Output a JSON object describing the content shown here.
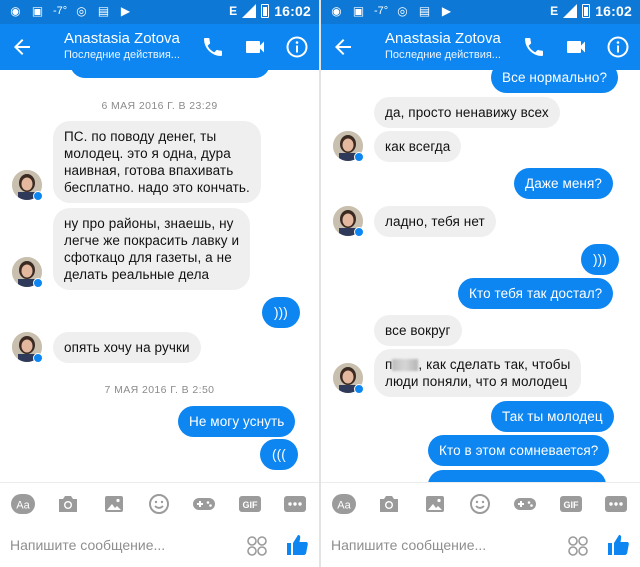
{
  "status_bar": {
    "temperature": "-7°",
    "network": "E",
    "time": "16:02"
  },
  "header": {
    "contact_name": "Anastasia Zotova",
    "contact_status": "Последние действия..."
  },
  "left_pane": {
    "timestamps": [
      "6 МАЯ 2016 Г. В 23:29",
      "7 МАЯ 2016 Г. В 2:50"
    ],
    "messages": [
      {
        "from": "contact",
        "lines": [
          "ПС. по поводу денег, ты",
          "молодец. это я одна, дура",
          "наивная, готова впахивать",
          "бесплатно. надо это кончать."
        ]
      },
      {
        "from": "contact",
        "lines": [
          "ну про районы, знаешь, ну",
          "легче же покрасить лавку и",
          "сфоткацо для газеты, а не",
          "делать реальные дела"
        ]
      },
      {
        "from": "me",
        "lines": [
          ")))"
        ]
      },
      {
        "from": "contact",
        "lines": [
          "опять хочу на ручки"
        ]
      },
      {
        "from": "me",
        "lines": [
          "Не могу уснуть"
        ]
      },
      {
        "from": "me",
        "lines": [
          "((("
        ]
      }
    ]
  },
  "right_pane": {
    "messages": [
      {
        "from": "me",
        "lines": [
          "Все нормально?"
        ]
      },
      {
        "from": "contact",
        "lines": [
          "да, просто ненавижу всех"
        ]
      },
      {
        "from": "contact",
        "lines": [
          "как всегда"
        ]
      },
      {
        "from": "me",
        "lines": [
          "Даже меня?"
        ]
      },
      {
        "from": "contact",
        "lines": [
          "ладно, тебя нет"
        ]
      },
      {
        "from": "me",
        "lines": [
          ")))"
        ]
      },
      {
        "from": "me",
        "lines": [
          "Кто тебя так достал?"
        ]
      },
      {
        "from": "contact",
        "lines": [
          "все вокруг"
        ]
      },
      {
        "from": "contact",
        "line1_before_blur": "п",
        "line1_after_blur": ", как сделать так, чтобы",
        "line2": "люди поняли, что я молодец"
      },
      {
        "from": "me",
        "lines": [
          "Так ты молодец"
        ]
      },
      {
        "from": "me",
        "lines": [
          "Кто в этом сомневается?"
        ]
      }
    ]
  },
  "composer": {
    "placeholder": "Напишите сообщение..."
  },
  "toolbar": {
    "icons": [
      "text-format-icon",
      "camera-icon",
      "gallery-icon",
      "emoji-icon",
      "games-icon",
      "gif-icon",
      "more-icon"
    ],
    "gif_label": "GIF",
    "aa_label": "Aa"
  },
  "colors": {
    "header_blue": "#0d86f2",
    "status_blue": "#0d78d6",
    "outgoing_bubble": "#0d86f2",
    "incoming_bubble": "#efefef"
  }
}
